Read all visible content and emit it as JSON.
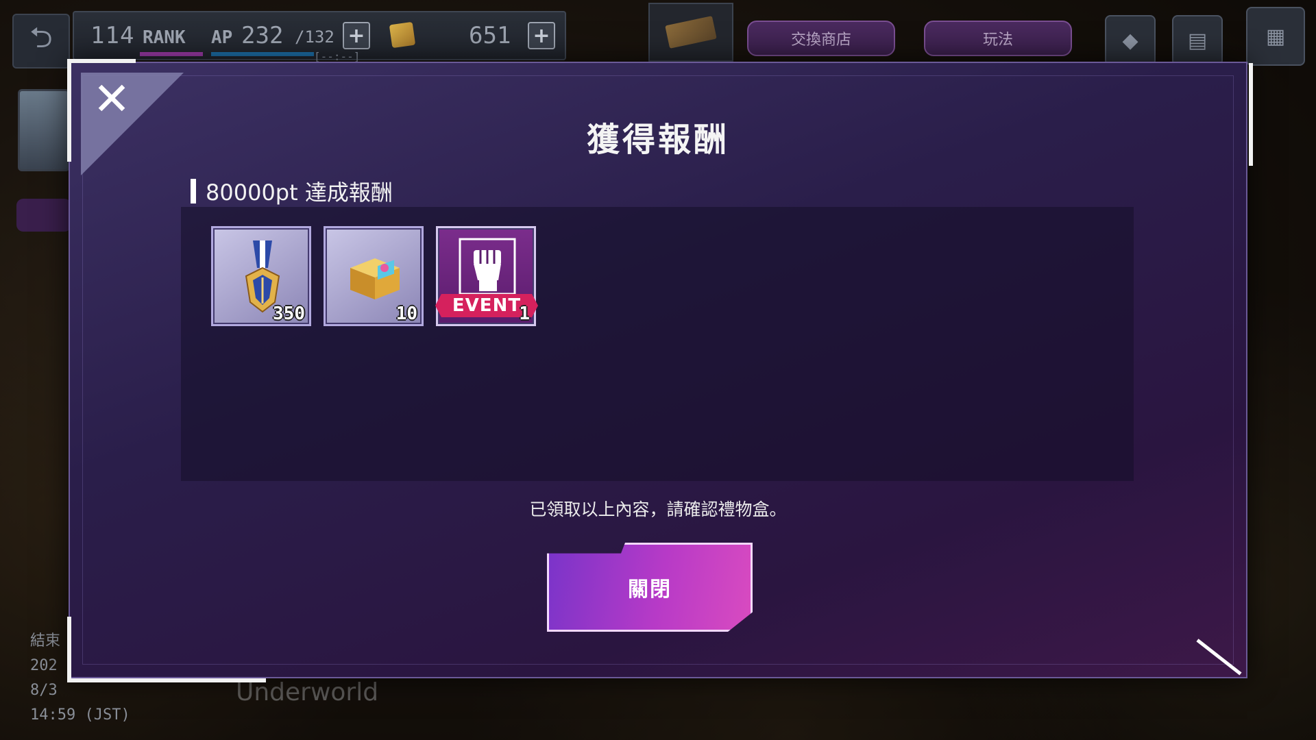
{
  "hud": {
    "rank_value": "114",
    "rank_label": "RANK",
    "ap_label": "AP",
    "ap_current": "232",
    "ap_max": "/132",
    "ap_timer": "[--:--]",
    "gem_count": "651",
    "shop_label": "交換商店",
    "howto_label": "玩法"
  },
  "side": {
    "end_label": "結束",
    "end_year": "202",
    "end_date": "8/3",
    "end_time": "14:59 (JST)",
    "area_name": "Underworld"
  },
  "modal": {
    "title": "獲得報酬",
    "section_label": "80000pt 達成報酬",
    "rewards": [
      {
        "icon": "medal-icon",
        "count": "350"
      },
      {
        "icon": "treasure-chest-icon",
        "count": "10"
      },
      {
        "icon": "event-fist-icon",
        "tag": "EVENT",
        "count": "1"
      }
    ],
    "notice": "已領取以上內容，請確認禮物盒。",
    "close_button": "關閉"
  },
  "colors": {
    "accent_pink": "#d5215d",
    "button_gradient_start": "#7a34c9",
    "button_gradient_end": "#d94bc0",
    "modal_bg": "#2a1e4a"
  }
}
